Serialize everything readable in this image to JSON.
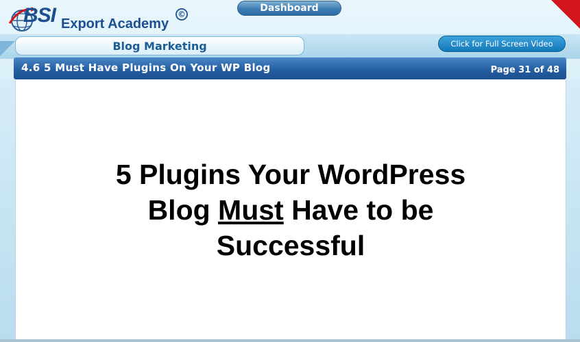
{
  "logo": {
    "brand": "BSI",
    "academy": "Export Academy",
    "copyright_symbol": "©"
  },
  "header": {
    "dashboard_label": "Dashboard",
    "section_label": "Blog Marketing",
    "fullscreen_label": "Click for Full Screen Video"
  },
  "lesson": {
    "title": "4.6 5 Must Have Plugins On Your WP Blog",
    "page_indicator": "Page 31 of 48"
  },
  "slide": {
    "line1": "5 Plugins Your WordPress",
    "line2_before": "Blog ",
    "line2_underlined": "Must",
    "line2_after": " Have to be",
    "line3": "Successful"
  },
  "colors": {
    "accent_blue": "#245fa3",
    "button_blue": "#1479b9",
    "corner_red": "#d3161b"
  }
}
